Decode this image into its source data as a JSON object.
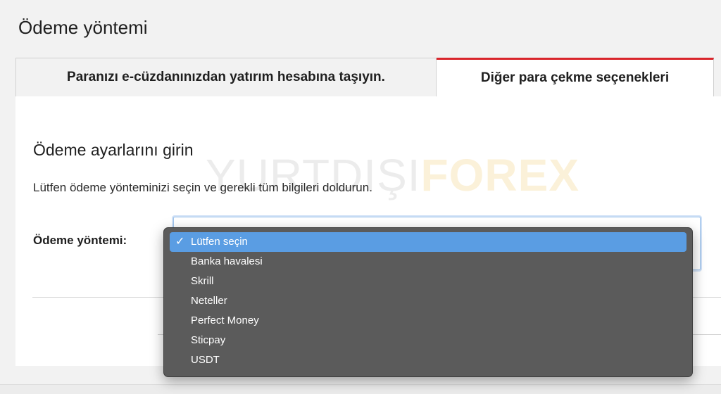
{
  "page": {
    "title": "Ödeme yöntemi"
  },
  "tabs": [
    {
      "label": "Paranızı e-cüzdanınızdan yatırım hesabına taşıyın.",
      "active": false
    },
    {
      "label": "Diğer para çekme seçenekleri",
      "active": true
    }
  ],
  "watermark": {
    "part1": "YURTDIŞI",
    "part2": "FOREX"
  },
  "form": {
    "section_title": "Ödeme ayarlarını girin",
    "instructions": "Lütfen ödeme yönteminizi seçin ve gerekli tüm bilgileri doldurun.",
    "payment_label": "Ödeme yöntemi:"
  },
  "dropdown": {
    "selected_index": 0,
    "check_glyph": "✓",
    "options": [
      "Lütfen seçin",
      "Banka havalesi",
      "Skrill",
      "Neteller",
      "Perfect Money",
      "Sticpay",
      "USDT"
    ]
  },
  "colors": {
    "accent_red": "#d9262c",
    "selection_blue": "#5a9de3",
    "dropdown_bg": "#5b5b5b"
  }
}
